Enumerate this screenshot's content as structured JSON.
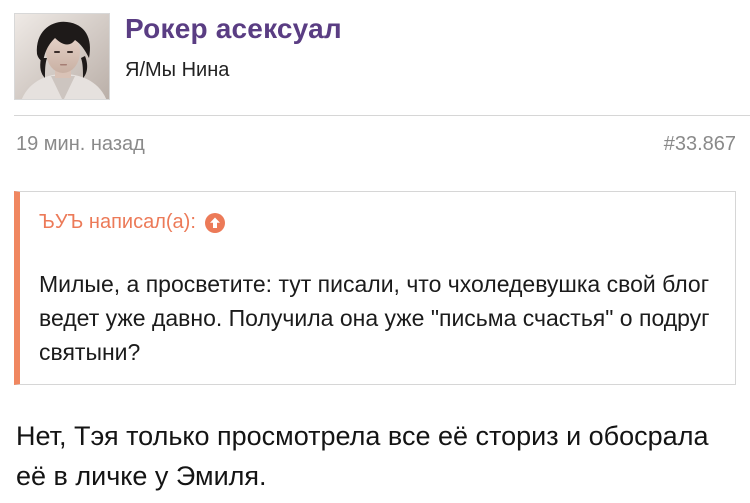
{
  "post": {
    "author": {
      "name": "Рокер асексуал",
      "title": "Я/Мы Нина"
    },
    "meta": {
      "time": "19 мин. назад",
      "number": "#33.867"
    },
    "quote": {
      "author_line": "ЪУЪ написал(а):",
      "text": "Милые, а просветите: тут писали, что чхоледевушка свой блог ведет уже давно. Получила она уже \"письма счастья\" о подруг святыни?"
    },
    "message": "Нет, Тэя только просмотрела все её сториз и обосрала её в личке у Эмиля."
  },
  "colors": {
    "username": "#5a3d83",
    "quote_accent": "#f08760",
    "meta_text": "#8a8a8a",
    "divider": "#d6d6d6"
  },
  "icons": {
    "avatar": "avatar-photo",
    "quote_jump": "arrow-up-circle-icon"
  }
}
